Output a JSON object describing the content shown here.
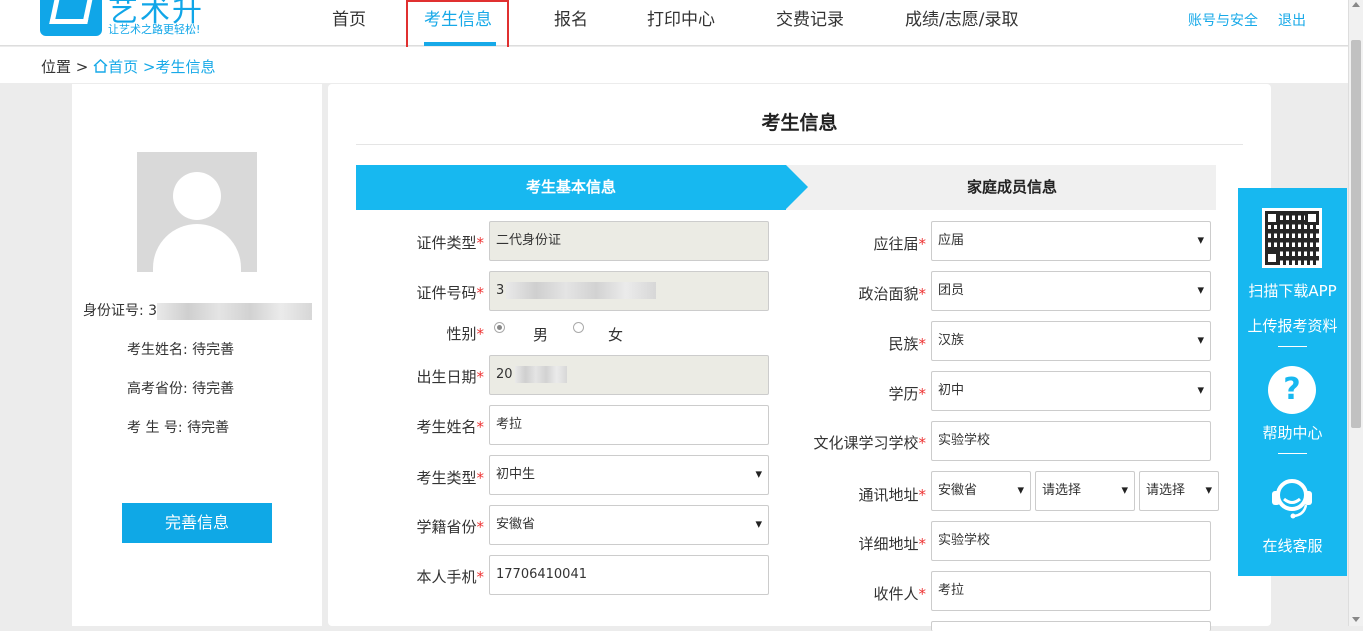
{
  "brand": {
    "name": "艺术升",
    "slogan": "让艺术之路更轻松!"
  },
  "nav": {
    "items": [
      "首页",
      "考生信息",
      "报名",
      "打印中心",
      "交费记录",
      "成绩/志愿/录取"
    ],
    "active": "考生信息"
  },
  "account": {
    "security": "账号与安全",
    "logout": "退出"
  },
  "breadcrumb": {
    "prefix": "位置 >",
    "home": "首页",
    "current": ">考生信息"
  },
  "sidebar": {
    "id_label": "身份证号: 3",
    "name_label": "考生姓名: 待完善",
    "province_label": "高考省份: 待完善",
    "examno_label": "考 生 号: 待完善",
    "button": "完善信息"
  },
  "main": {
    "title": "考生信息",
    "tabs": [
      "考生基本信息",
      "家庭成员信息"
    ]
  },
  "left_form": {
    "id_type": {
      "label": "证件类型",
      "value": "二代身份证"
    },
    "id_number": {
      "label": "证件号码",
      "value": "3"
    },
    "gender": {
      "label": "性别",
      "options": [
        "男",
        "女"
      ],
      "selected": "男"
    },
    "birth": {
      "label": "出生日期",
      "value": "20"
    },
    "name": {
      "label": "考生姓名",
      "value": "考拉"
    },
    "student_type": {
      "label": "考生类型",
      "value": "初中生"
    },
    "school_province": {
      "label": "学籍省份",
      "value": "安徽省"
    },
    "phone": {
      "label": "本人手机",
      "value": "17706410041"
    }
  },
  "right_form": {
    "grad_type": {
      "label": "应往届",
      "value": "应届"
    },
    "politics": {
      "label": "政治面貌",
      "value": "团员"
    },
    "ethnicity": {
      "label": "民族",
      "value": "汉族"
    },
    "education": {
      "label": "学历",
      "value": "初中"
    },
    "school": {
      "label": "文化课学习学校",
      "value": "实验学校"
    },
    "address": {
      "label": "通讯地址",
      "province": "安徽省",
      "city": "请选择",
      "district": "请选择"
    },
    "detail_address": {
      "label": "详细地址",
      "value": "实验学校"
    },
    "receiver": {
      "label": "收件人",
      "value": "考拉"
    }
  },
  "required_mark": "*",
  "float_panel": {
    "download": "扫描下载APP",
    "upload": "上传报考资料",
    "help": "帮助中心",
    "service": "在线客服"
  },
  "colors": {
    "accent": "#17b8f0",
    "link": "#17a9e8",
    "required": "#e33333",
    "highlight_box": "#e03030"
  }
}
